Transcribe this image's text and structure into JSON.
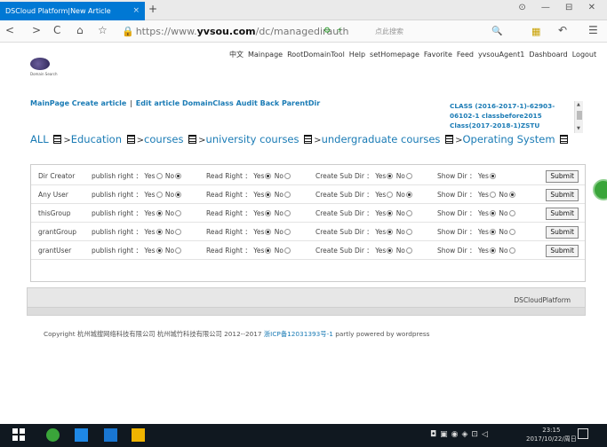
{
  "browser": {
    "tab_title": "DSCloud Platform|New Article",
    "tab_close": "×",
    "new_tab": "+",
    "window_controls": "⊙ — ⊟ ✕",
    "url_prefix": "https://www.",
    "url_domain": "yvsou.com",
    "url_path": "/dc/managedirauth",
    "search_placeholder": "点此搜索",
    "nav": {
      "back": "<",
      "forward": ">",
      "reload": "C",
      "home": "⌂",
      "star": "☆",
      "menu": "☰",
      "undo": "↶"
    }
  },
  "header": {
    "logo_label": "Domain Search",
    "menu": [
      "中文",
      "Mainpage",
      "RootDomainTool",
      "Help",
      "setHomepage",
      "Favorite",
      "Feed",
      "yvsouAgent1",
      "Dashboard",
      "Logout"
    ]
  },
  "crumbs": [
    "MainPage",
    "Create article",
    "Edit article",
    "DomainClass",
    "Audit",
    "Back",
    "ParentDir"
  ],
  "class_box": "CLASS (2016-2017-1)-62903-06102-1 classbefore2015 Class(2017-2018-1)ZSTU",
  "path": [
    "ALL",
    "Education",
    "courses",
    "university courses",
    "undergraduate courses",
    "Operating System"
  ],
  "permissions": {
    "labels": {
      "publish": "publish right ：",
      "read": "Read Right ：",
      "create": "Create Sub Dir ：",
      "show": "Show Dir ：",
      "yes": "Yes",
      "no": "No",
      "submit": "Submit"
    },
    "rows": [
      {
        "name": "Dir Creator",
        "publish": "no",
        "read": "yes",
        "create": "yes",
        "show": "yes",
        "show_no": false
      },
      {
        "name": "Any User",
        "publish": "no",
        "read": "yes",
        "create": "no",
        "show": "no",
        "show_no": true
      },
      {
        "name": "thisGroup",
        "publish": "yes",
        "read": "yes",
        "create": "yes",
        "show": "yes",
        "show_no": true
      },
      {
        "name": "grantGroup",
        "publish": "yes",
        "read": "yes",
        "create": "yes",
        "show": "yes",
        "show_no": true
      },
      {
        "name": "grantUser",
        "publish": "yes",
        "read": "yes",
        "create": "yes",
        "show": "yes",
        "show_no": true
      }
    ]
  },
  "footer": {
    "platform": "DSCloudPlatform",
    "copyright_main": "Copyright 杭州城搜网络科技有限公司 杭州城竹科技有限公司 2012--2017",
    "icp": "浙ICP备12031393号-1",
    "copyright_tail": "partly powered by wordpress"
  },
  "taskbar": {
    "time": "23:15",
    "date": "2017/10/22/周日"
  }
}
